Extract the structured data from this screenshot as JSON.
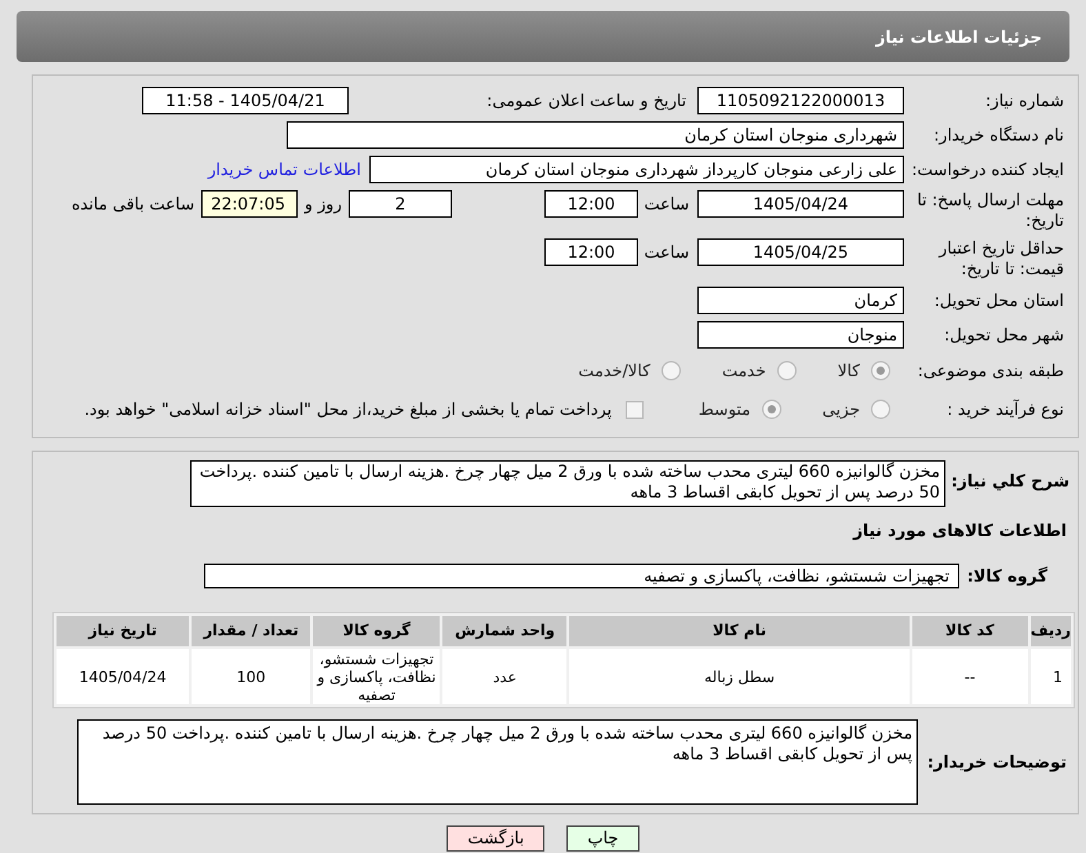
{
  "header": {
    "title": "جزئیات اطلاعات نیاز"
  },
  "info": {
    "need_number": {
      "label": "شماره نیاز:",
      "value": "1105092122000013"
    },
    "announce": {
      "label": "تاریخ و ساعت اعلان عمومی:",
      "value": "1405/04/21 - 11:58"
    },
    "buyer_org": {
      "label": "نام دستگاه خریدار:",
      "value": "شهرداری منوجان استان کرمان"
    },
    "creator": {
      "label": "ایجاد کننده درخواست:",
      "value": "علی زارعی منوجان کارپرداز شهرداری منوجان استان کرمان",
      "link": "اطلاعات تماس خریدار"
    },
    "deadline": {
      "label": "مهلت ارسال پاسخ: تا تاریخ:",
      "date": "1405/04/24",
      "time_label": "ساعت",
      "time": "12:00",
      "days": "2",
      "days_label": "روز و",
      "remaining": "22:07:05",
      "remaining_label": "ساعت باقی مانده"
    },
    "validity": {
      "label": "حداقل تاریخ اعتبار قیمت: تا تاریخ:",
      "date": "1405/04/25",
      "time_label": "ساعت",
      "time": "12:00"
    },
    "province": {
      "label": "استان محل تحویل:",
      "value": "کرمان"
    },
    "city": {
      "label": "شهر محل تحویل:",
      "value": "منوجان"
    },
    "category": {
      "label": "طبقه بندی موضوعی:",
      "options": [
        {
          "label": "کالا",
          "selected": true
        },
        {
          "label": "خدمت",
          "selected": false
        },
        {
          "label": "کالا/خدمت",
          "selected": false
        }
      ]
    },
    "process": {
      "label": "نوع فرآیند خرید :",
      "options": [
        {
          "label": "جزیی",
          "selected": false
        },
        {
          "label": "متوسط",
          "selected": true
        }
      ],
      "treasury": {
        "label": "پرداخت تمام یا بخشی از مبلغ خرید،از محل \"اسناد خزانه اسلامی\" خواهد بود.",
        "checked": false
      }
    }
  },
  "details": {
    "summary_label": "شرح كلي نیاز:",
    "summary": "مخزن گالوانیزه 660 لیتری محدب ساخته شده با ورق 2 میل چهار چرخ .هزینه ارسال با تامین کننده .پرداخت 50 درصد پس از تحویل کابقی اقساط 3 ماهه",
    "goods_heading": "اطلاعات کالاهای مورد نیاز",
    "group_label": "گروه کالا:",
    "group": "تجهیزات شستشو، نظافت، پاکسازی و تصفیه",
    "table": {
      "columns": [
        "ردیف",
        "کد کالا",
        "نام کالا",
        "واحد شمارش",
        "گروه کالا",
        "تعداد / مقدار",
        "تاریخ نیاز"
      ],
      "rows": [
        [
          "1",
          "--",
          "سطل زباله",
          "عدد",
          "تجهیزات شستشو، نظافت، پاکسازی و تصفیه",
          "100",
          "1405/04/24"
        ]
      ]
    },
    "notes_label": "توضیحات خریدار:",
    "notes": "مخزن گالوانیزه 660 لیتری محدب ساخته شده با ورق 2 میل چهار چرخ .هزینه ارسال با تامین کننده .پرداخت 50 درصد پس از تحویل کابقی اقساط 3 ماهه"
  },
  "buttons": [
    {
      "kind": "print",
      "label": "چاپ"
    },
    {
      "kind": "back",
      "label": "بازگشت"
    }
  ]
}
